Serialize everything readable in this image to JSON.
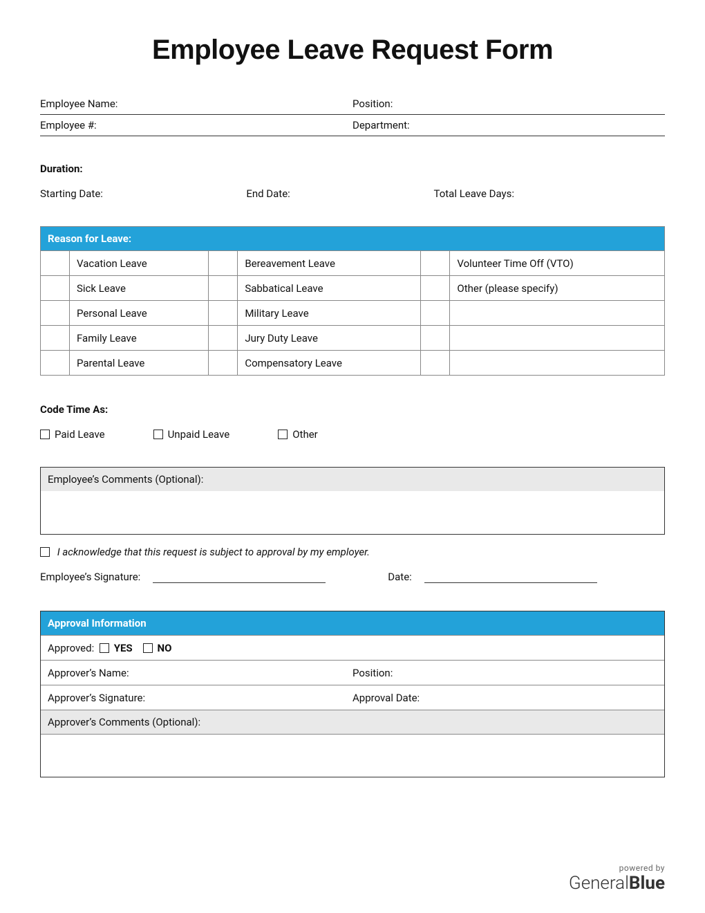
{
  "title": "Employee Leave Request Form",
  "fields": {
    "employee_name": "Employee Name:",
    "position": "Position:",
    "employee_num": "Employee #:",
    "department": "Department:"
  },
  "duration": {
    "heading": "Duration",
    "starting": "Starting Date:",
    "end": "End Date:",
    "total": "Total Leave Days:"
  },
  "reason": {
    "header": "Reason for Leave:",
    "col1": [
      "Vacation Leave",
      "Sick Leave",
      "Personal Leave",
      "Family Leave",
      "Parental Leave"
    ],
    "col2": [
      "Bereavement Leave",
      "Sabbatical Leave",
      "Military Leave",
      "Jury Duty Leave",
      "Compensatory Leave"
    ],
    "col3": [
      "Volunteer Time Off (VTO)",
      "Other (please specify)",
      "",
      "",
      ""
    ]
  },
  "codetime": {
    "heading": "Code Time As:",
    "opts": [
      "Paid Leave",
      "Unpaid Leave",
      "Other"
    ]
  },
  "comments_label": "Employee’s Comments (Optional):",
  "ack": "I acknowledge that this request is subject to approval by my employer.",
  "sig": {
    "emp_sig": "Employee’s Signature:",
    "date": "Date:"
  },
  "approval": {
    "header": "Approval Information",
    "approved": "Approved:",
    "yes": "YES",
    "no": "NO",
    "name": "Approver’s Name:",
    "position": "Position:",
    "signature": "Approver’s Signature:",
    "approval_date": "Approval Date:",
    "comments": "Approver’s Comments (Optional):"
  },
  "footer": {
    "powered": "powered by",
    "brand1": "General",
    "brand2": "Blue"
  }
}
